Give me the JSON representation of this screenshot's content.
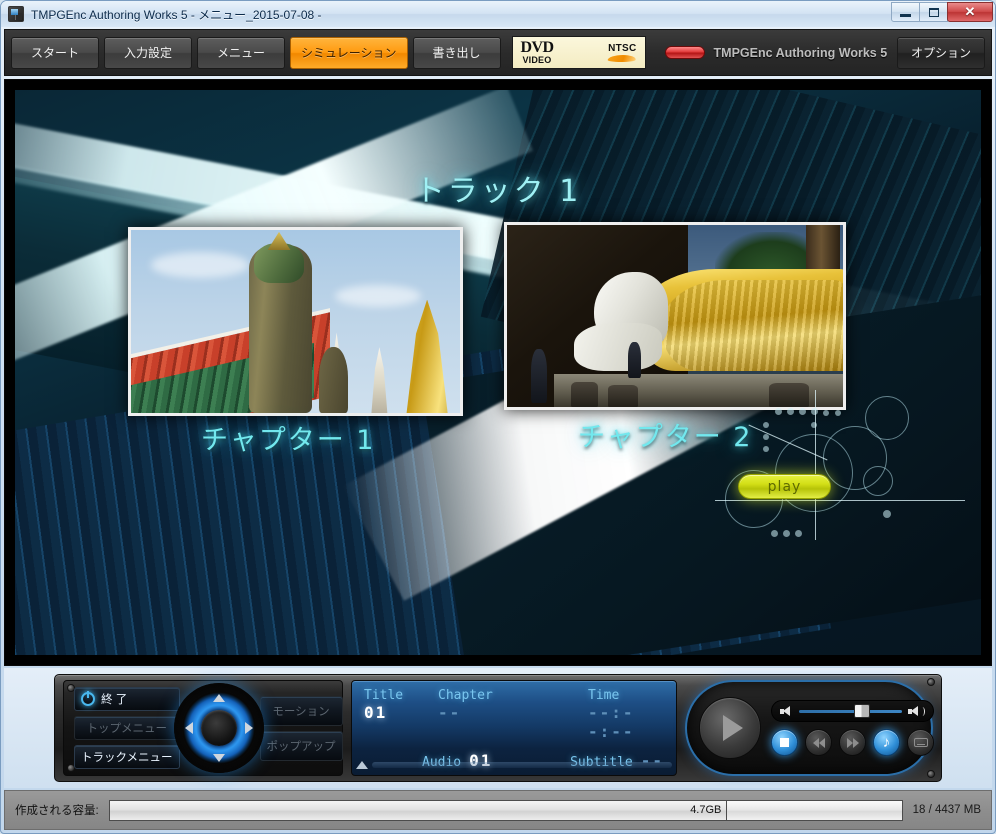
{
  "window": {
    "title": "TMPGEnc Authoring Works 5 - メニュー_2015-07-08 -",
    "app_icon": "app-icon",
    "minimize_label": "Minimize",
    "maximize_label": "Restore",
    "close_label": "✕"
  },
  "toolbar": {
    "tabs": [
      {
        "label": "スタート",
        "active": false
      },
      {
        "label": "入力設定",
        "active": false
      },
      {
        "label": "メニュー",
        "active": false
      },
      {
        "label": "シミュレーション",
        "active": true
      },
      {
        "label": "書き出し",
        "active": false
      }
    ],
    "format_badge": {
      "top": "DVD",
      "bottom": "VIDEO",
      "standard": "NTSC"
    },
    "brand_text": "TMPGEnc Authoring Works 5",
    "options_label": "オプション",
    "accent_color": "#ff9a10"
  },
  "preview": {
    "track_title": "トラック 1",
    "chapters": [
      {
        "label": "チャプター 1"
      },
      {
        "label": "チャプター 2"
      }
    ],
    "play_button_label": "play",
    "play_button_color": "#d2de16",
    "menu_text_color": "#72e8ee"
  },
  "remote": {
    "buttons": {
      "exit": "終 了",
      "top_menu": "トップメニュー",
      "track_menu": "トラックメニュー",
      "motion": "モーション",
      "popup": "ポップアップ"
    },
    "dpad": {
      "up": "▲",
      "down": "▼",
      "left": "◀",
      "right": "▶"
    }
  },
  "info_display": {
    "title_label": "Title",
    "title_value": "01",
    "chapter_label": "Chapter",
    "chapter_value": "--",
    "time_label": "Time",
    "time_value": "--:--:--",
    "audio_label": "Audio",
    "audio_value": "01",
    "subtitle_label": "Subtitle",
    "subtitle_value": "--",
    "label_color": "#79c6ef"
  },
  "playback": {
    "play_label": "Play",
    "stop_label": "Stop",
    "prev_label": "Previous",
    "next_label": "Next",
    "audio_label": "Audio",
    "subtitle_label": "Subtitle",
    "volume_percent": 61
  },
  "statusbar": {
    "capacity_label": "作成される容量:",
    "disc_size": "4.7GB",
    "usage": "18 / 4437 MB"
  }
}
